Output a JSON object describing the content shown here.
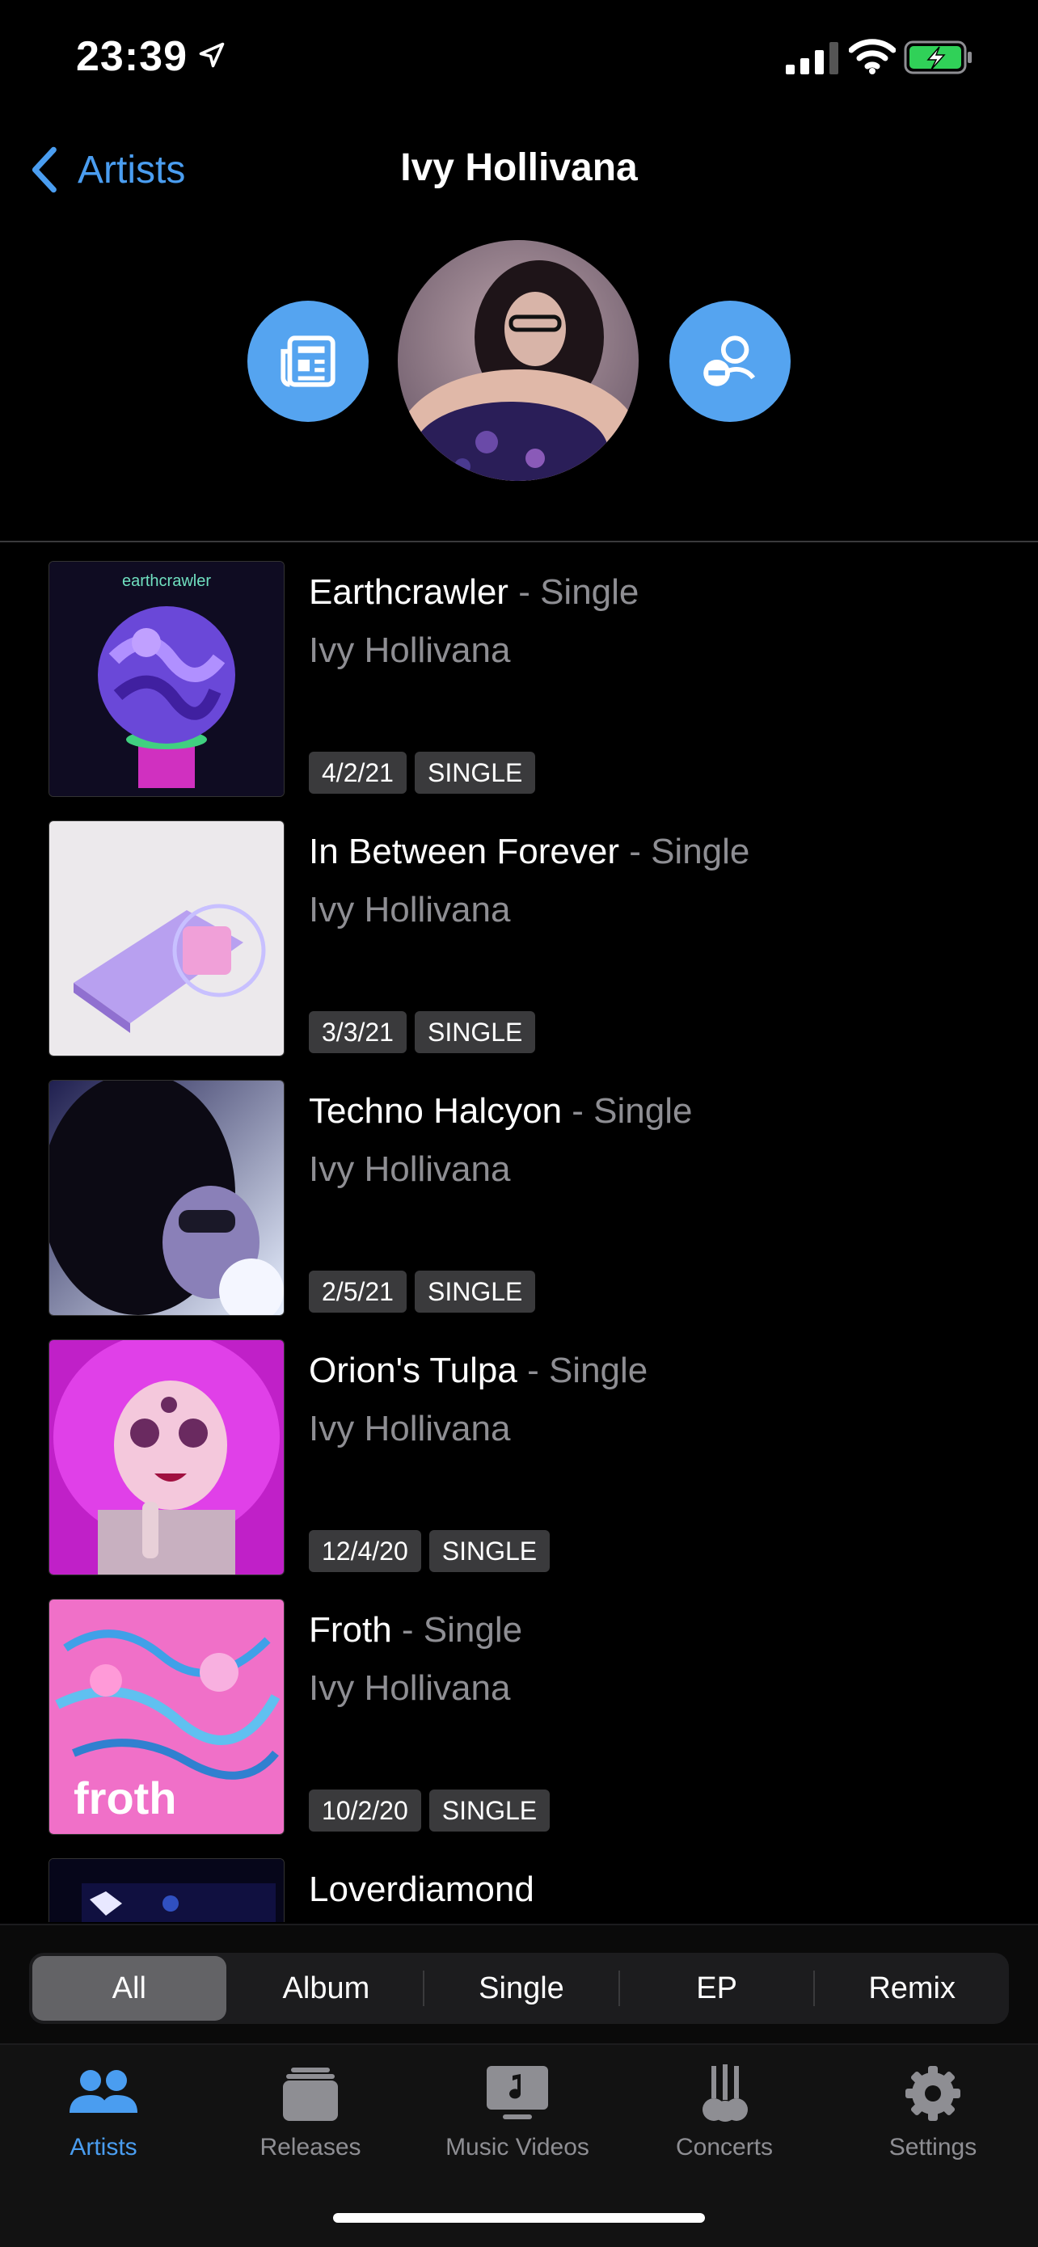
{
  "status_bar": {
    "time": "23:39",
    "icons": [
      "location-arrow-icon",
      "signal-icon",
      "wifi-icon",
      "battery-charging-icon"
    ],
    "battery_color": "#30d158"
  },
  "nav": {
    "back_label": "Artists",
    "title": "Ivy Hollivana"
  },
  "header": {
    "left_button_icon": "news-icon",
    "right_button_icon": "remove-person-icon",
    "avatar": "artist-photo"
  },
  "releases": [
    {
      "title": "Earthcrawler",
      "suffix": " - Single",
      "artist": "Ivy Hollivana",
      "date": "4/2/21",
      "type": "SINGLE"
    },
    {
      "title": "In Between Forever",
      "suffix": " - Single",
      "artist": "Ivy Hollivana",
      "date": "3/3/21",
      "type": "SINGLE"
    },
    {
      "title": "Techno Halcyon",
      "suffix": " - Single",
      "artist": "Ivy Hollivana",
      "date": "2/5/21",
      "type": "SINGLE"
    },
    {
      "title": "Orion's Tulpa",
      "suffix": " - Single",
      "artist": "Ivy Hollivana",
      "date": "12/4/20",
      "type": "SINGLE"
    },
    {
      "title": "Froth",
      "suffix": " - Single",
      "artist": "Ivy Hollivana",
      "date": "10/2/20",
      "type": "SINGLE"
    },
    {
      "title": "Loverdiamond",
      "suffix": "",
      "artist": "",
      "date": "",
      "type": ""
    }
  ],
  "filter": {
    "segments": [
      "All",
      "Album",
      "Single",
      "EP",
      "Remix"
    ],
    "selected": "All"
  },
  "tab_bar": {
    "items": [
      {
        "label": "Artists",
        "icon": "people-icon",
        "active": true
      },
      {
        "label": "Releases",
        "icon": "stack-icon",
        "active": false
      },
      {
        "label": "Music Videos",
        "icon": "music-tv-icon",
        "active": false
      },
      {
        "label": "Concerts",
        "icon": "guitars-icon",
        "active": false
      },
      {
        "label": "Settings",
        "icon": "gear-icon",
        "active": false
      }
    ]
  },
  "colors": {
    "accent": "#4a9df0",
    "button_blue": "#55a4f0",
    "secondary_text": "#8e8e93",
    "tag_bg": "#3a3a3c"
  }
}
